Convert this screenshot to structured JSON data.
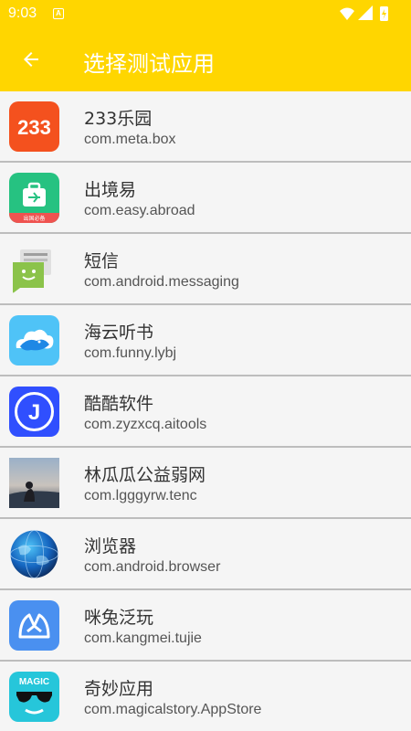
{
  "status_bar": {
    "time": "9:03",
    "a_badge": "A"
  },
  "toolbar": {
    "title": "选择测试应用",
    "back_icon": "arrow-left-icon"
  },
  "apps": [
    {
      "name": "233乐园",
      "package": "com.meta.box",
      "icon": "233-logo-icon",
      "icon_text": "233",
      "color": "#f4511e"
    },
    {
      "name": "出境易",
      "package": "com.easy.abroad",
      "icon": "suitcase-icon",
      "icon_text": "出国必备",
      "color": "#26c281"
    },
    {
      "name": "短信",
      "package": "com.android.messaging",
      "icon": "message-bubble-icon",
      "color": "#8bc34a"
    },
    {
      "name": "海云听书",
      "package": "com.funny.lybj",
      "icon": "cloud-whale-icon",
      "color": "#4fc3f7"
    },
    {
      "name": "酷酷软件",
      "package": "com.zyzxcq.aitools",
      "icon": "letter-j-icon",
      "icon_text": "J",
      "color": "#304ffe"
    },
    {
      "name": "林瓜瓜公益弱网",
      "package": "com.lgggyrw.tenc",
      "icon": "photo-person-icon",
      "color": "#7b8fa8"
    },
    {
      "name": "浏览器",
      "package": "com.android.browser",
      "icon": "globe-icon",
      "color": "#1976d2"
    },
    {
      "name": "咪兔泛玩",
      "package": "com.kangmei.tujie",
      "icon": "rabbit-face-icon",
      "color": "#4a90f0"
    },
    {
      "name": "奇妙应用",
      "package": "com.magicalstory.AppStore",
      "icon": "sunglasses-icon",
      "icon_text": "MAGIC",
      "color": "#26c6da"
    }
  ]
}
